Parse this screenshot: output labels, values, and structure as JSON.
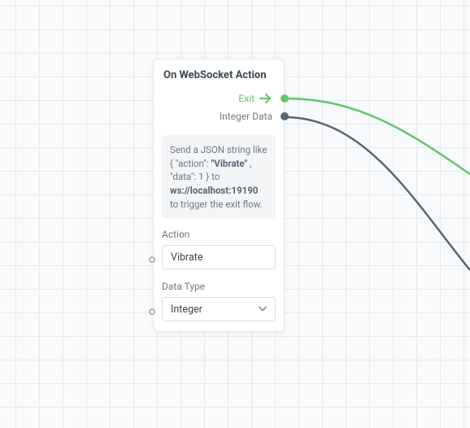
{
  "node": {
    "title": "On WebSocket Action",
    "ports": {
      "exit_label": "Exit",
      "data_label": "Integer Data"
    },
    "hint": {
      "prefix": "Send a JSON string like { \"action\": ",
      "action_value": "\"Vibrate\"",
      "mid": ", \"data\": 1 } to ",
      "url": "ws://localhost:19190",
      "suffix": " to trigger the exit flow."
    },
    "fields": {
      "action_label": "Action",
      "action_value": "Vibrate",
      "datatype_label": "Data Type",
      "datatype_value": "Integer"
    }
  },
  "colors": {
    "exit_wire": "#63c66a",
    "data_wire": "#5a6570"
  }
}
